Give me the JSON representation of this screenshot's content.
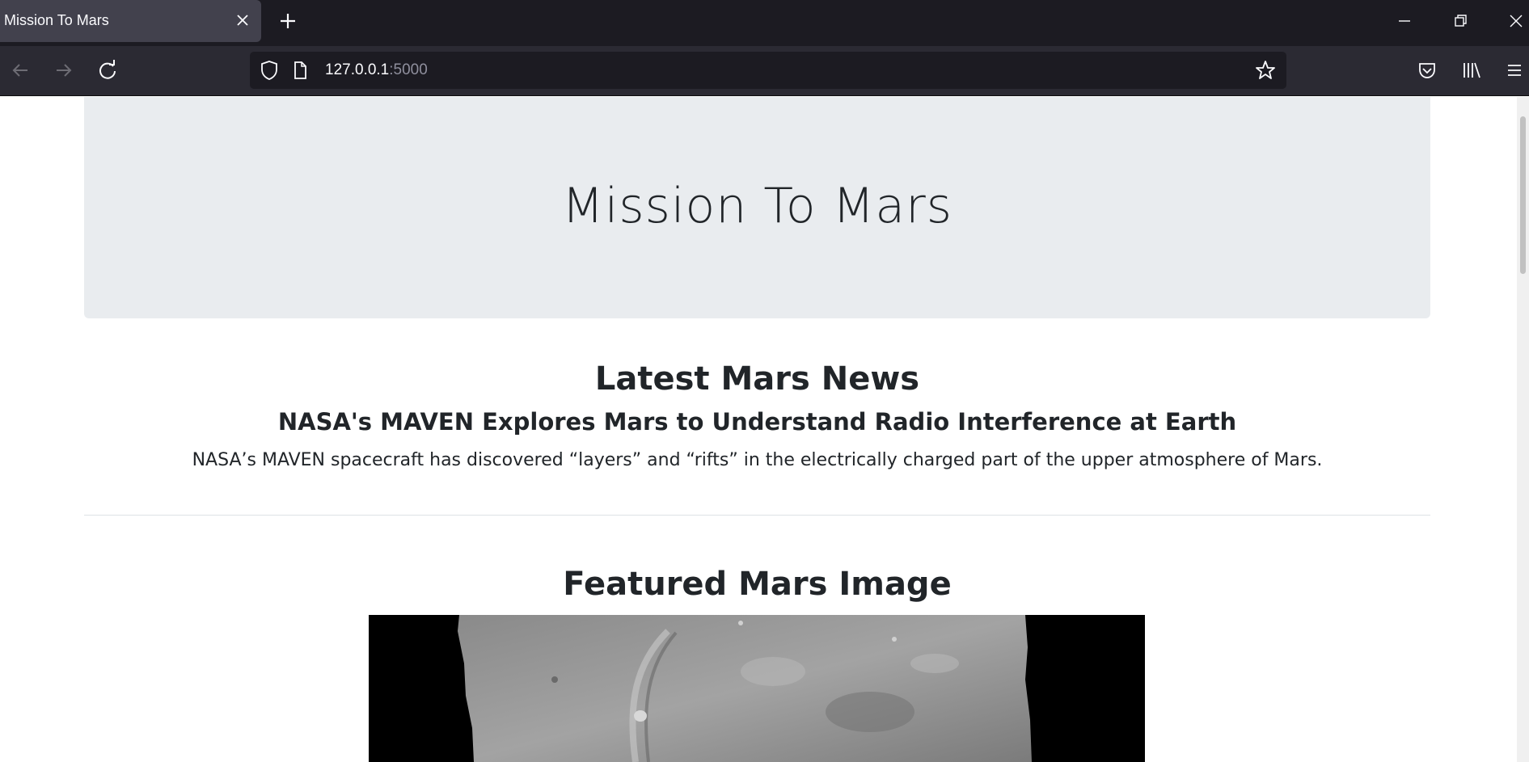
{
  "browser": {
    "tab_title": "Mission To Mars",
    "url_host": "127.0.0.1",
    "url_port": ":5000",
    "icons": [
      "close-icon",
      "plus-icon",
      "minimize-icon",
      "restore-icon",
      "window-close-icon",
      "back-arrow-icon",
      "forward-arrow-icon",
      "reload-icon",
      "shield-icon",
      "page-icon",
      "star-icon",
      "pocket-icon",
      "library-icon",
      "menu-icon"
    ]
  },
  "page": {
    "jumbotron_title": "Mission To Mars",
    "news": {
      "heading": "Latest Mars News",
      "title": "NASA's MAVEN Explores Mars to Understand Radio Interference at Earth",
      "paragraph": "NASA’s MAVEN spacecraft has discovered “layers” and “rifts” in the electrically charged part of the upper atmosphere of Mars."
    },
    "featured": {
      "heading": "Featured Mars Image"
    }
  },
  "colors": {
    "tabbar_bg": "#1c1b22",
    "navbar_bg": "#2b2a33",
    "jumbotron_bg": "#e9ecef",
    "text": "#212529"
  }
}
